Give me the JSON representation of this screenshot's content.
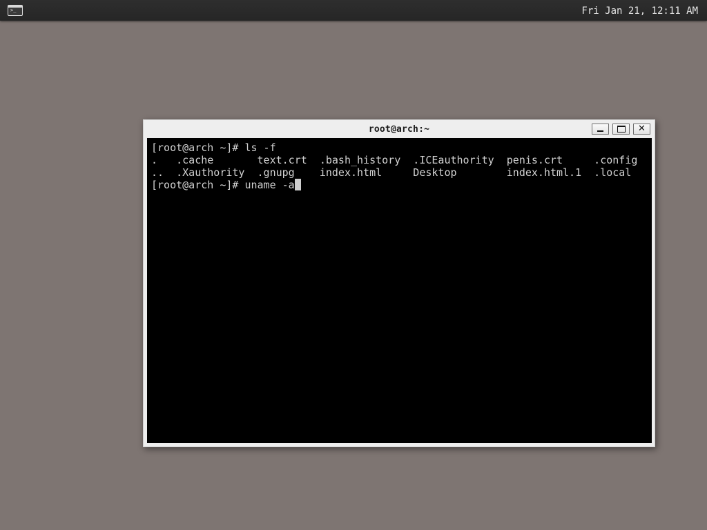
{
  "panel": {
    "launcher_icon": "terminal-icon",
    "launcher_glyph": ">_",
    "clock": "Fri Jan 21, 12:11 AM"
  },
  "window": {
    "title": "root@arch:~",
    "minimize_icon": "minimize-icon",
    "maximize_icon": "maximize-icon",
    "close_icon": "close-icon",
    "close_glyph": "✕"
  },
  "terminal": {
    "lines": [
      "[root@arch ~]# ls -f",
      ".   .cache       text.crt  .bash_history  .ICEauthority  penis.crt     .config",
      "..  .Xauthority  .gnupg    index.html     Desktop        index.html.1  .local"
    ],
    "prompt": "[root@arch ~]# ",
    "current_input": "uname -a"
  },
  "colors": {
    "desktop_bg": "#7e7572",
    "panel_bg": "#2b2b2b",
    "terminal_bg": "#000000",
    "terminal_fg": "#d2d2d2"
  }
}
